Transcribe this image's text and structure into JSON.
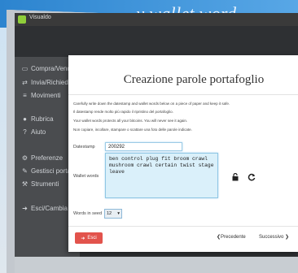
{
  "banner": {
    "text": "...y wallet word generator"
  },
  "window": {
    "title": "Visualdo"
  },
  "sidebar": {
    "items": [
      {
        "label": "Compra/Vendi",
        "icon": "card-icon"
      },
      {
        "label": "Invia/Richiedi",
        "icon": "transfer-icon"
      },
      {
        "label": "Movimenti",
        "icon": "list-icon"
      },
      {
        "label": "Rubrica",
        "icon": "person-icon"
      },
      {
        "label": "Aiuto",
        "icon": "question-icon"
      },
      {
        "label": "Preferenze",
        "icon": "gear-icon"
      },
      {
        "label": "Gestisci portafogli",
        "icon": "edit-icon"
      },
      {
        "label": "Strumenti",
        "icon": "wrench-icon"
      },
      {
        "label": "Esci/Cambia",
        "icon": "exit-icon"
      }
    ]
  },
  "modal": {
    "title": "Creazione parole portafoglio",
    "instructions": [
      "Carefully write down the datestamp and wallet words below on a piece of paper and keep it safe.",
      "Il datestamp rende molto più rapido il ripristino del portafoglio.",
      "Your wallet words protects all your bitcoins. You will never see it again.",
      "Non copiare, incollare, stampare o scattare una foto delle parole indicate."
    ],
    "datestamp_label": "Datestamp",
    "datestamp_value": "200292",
    "wallet_words_label": "Wallet words",
    "wallet_words": "ben control plug fit broom crawl mushroom crawl certain twist stage leave",
    "words_in_seed_label": "Words in seed",
    "words_in_seed_value": "12",
    "exit_label": "Esci",
    "prev_label": "Precedente",
    "next_label": "Successivo"
  }
}
